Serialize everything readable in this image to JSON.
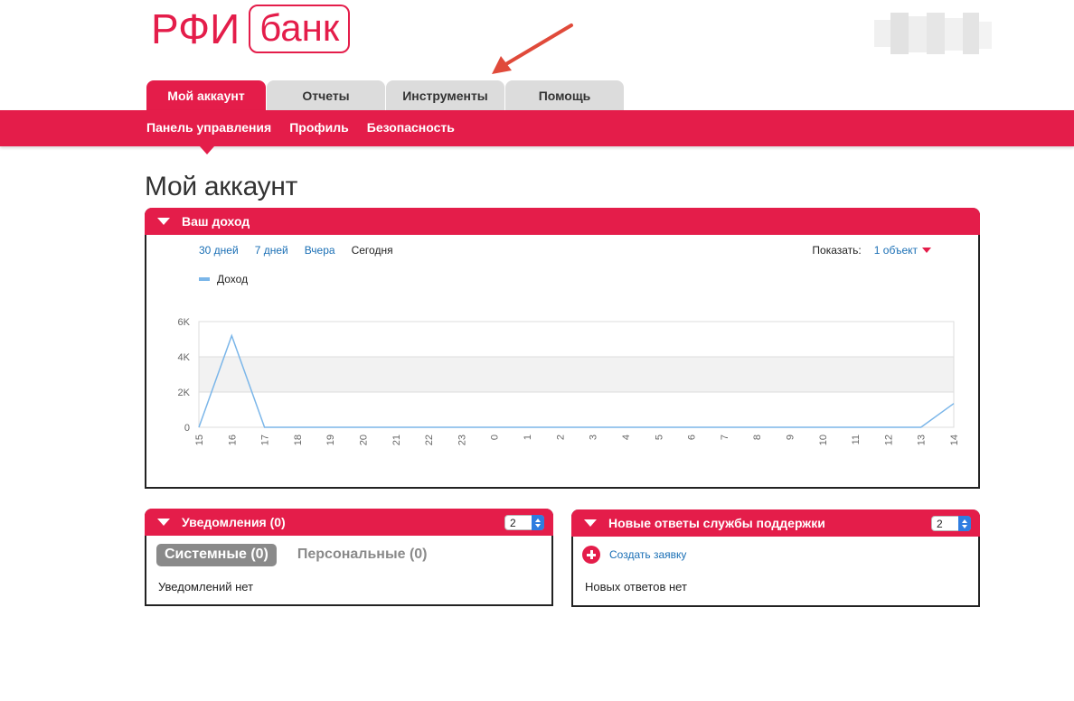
{
  "logo": {
    "part1": "РФИ",
    "part2": "банк"
  },
  "tabs": [
    {
      "label": "Мой аккаунт",
      "active": true
    },
    {
      "label": "Отчеты",
      "active": false
    },
    {
      "label": "Инструменты",
      "active": false
    },
    {
      "label": "Помощь",
      "active": false
    }
  ],
  "subnav": [
    {
      "label": "Панель управления"
    },
    {
      "label": "Профиль"
    },
    {
      "label": "Безопасность"
    }
  ],
  "page": {
    "title": "Мой аккаунт"
  },
  "income_panel": {
    "title": "Ваш доход",
    "ranges": [
      {
        "label": "30 дней",
        "current": false
      },
      {
        "label": "7 дней",
        "current": false
      },
      {
        "label": "Вчера",
        "current": false
      },
      {
        "label": "Сегодня",
        "current": true
      }
    ],
    "show_label": "Показать:",
    "show_value": "1 объект"
  },
  "chart_data": {
    "type": "line",
    "title": "",
    "xlabel": "",
    "ylabel": "",
    "x": [
      "15",
      "16",
      "17",
      "18",
      "19",
      "20",
      "21",
      "22",
      "23",
      "0",
      "1",
      "2",
      "3",
      "4",
      "5",
      "6",
      "7",
      "8",
      "9",
      "10",
      "11",
      "12",
      "13",
      "14"
    ],
    "series": [
      {
        "name": "Доход",
        "values": [
          0,
          5200,
          0,
          0,
          0,
          0,
          0,
          0,
          0,
          0,
          0,
          0,
          0,
          0,
          0,
          0,
          0,
          0,
          0,
          0,
          0,
          0,
          0,
          1350
        ]
      }
    ],
    "ylim": [
      0,
      6000
    ],
    "yticks": [
      0,
      2000,
      4000,
      6000
    ],
    "ytick_labels": [
      "0",
      "2K",
      "4K",
      "6K"
    ],
    "grid": true,
    "color": "#7bb6e9"
  },
  "notifications_panel": {
    "title": "Уведомления (0)",
    "per_page": "2",
    "tabs": [
      {
        "label": "Системные (0)",
        "active": true
      },
      {
        "label": "Персональные (0)",
        "active": false
      }
    ],
    "empty_text": "Уведомлений нет"
  },
  "support_panel": {
    "title": "Новые ответы службы поддержки",
    "per_page": "2",
    "create_label": "Создать заявку",
    "empty_text": "Новых ответов нет"
  },
  "colors": {
    "brand": "#e41d4a",
    "link": "#1a6fb5",
    "series": "#7bb6e9"
  }
}
